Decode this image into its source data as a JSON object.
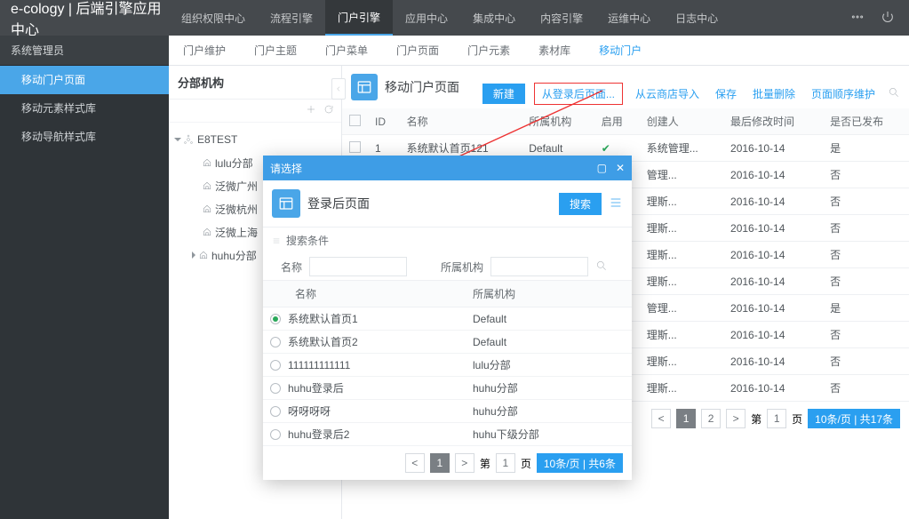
{
  "brand": "e-cology | 后端引擎应用中心",
  "topnav": [
    "组织权限中心",
    "流程引擎",
    "门户引擎",
    "应用中心",
    "集成中心",
    "内容引擎",
    "运维中心",
    "日志中心"
  ],
  "topnav_active": 2,
  "user_label": "系统管理员",
  "sidemenu": [
    "移动门户页面",
    "移动元素样式库",
    "移动导航样式库"
  ],
  "sidemenu_active": 0,
  "subtabs": [
    "门户维护",
    "门户主题",
    "门户菜单",
    "门户页面",
    "门户元素",
    "素材库",
    "移动门户"
  ],
  "subtabs_active": 6,
  "org_title": "分部机构",
  "tree": {
    "root": "E8TEST",
    "children": [
      "lulu分部",
      "泛微广州",
      "泛微杭州",
      "泛微上海",
      "huhu分部"
    ]
  },
  "page_title": "移动门户页面",
  "actions": {
    "new": "新建",
    "from_login": "从登录后页面...",
    "from_store": "从云商店导入",
    "save": "保存",
    "batch_del": "批量删除",
    "order": "页面顺序维护"
  },
  "table": {
    "cols": [
      "",
      "ID",
      "名称",
      "所属机构",
      "启用",
      "创建人",
      "最后修改时间",
      "是否已发布"
    ],
    "rows": [
      {
        "id": "1",
        "name": "系统默认首页121",
        "org": "Default",
        "enabled": true,
        "creator": "系统管理...",
        "mtime": "2016-10-14",
        "pub": "是"
      },
      {
        "id": "",
        "name": "",
        "org": "",
        "enabled": false,
        "creator": "管理...",
        "mtime": "2016-10-14",
        "pub": "否"
      },
      {
        "id": "",
        "name": "",
        "org": "",
        "enabled": false,
        "creator": "理斯...",
        "mtime": "2016-10-14",
        "pub": "否"
      },
      {
        "id": "",
        "name": "",
        "org": "",
        "enabled": false,
        "creator": "理斯...",
        "mtime": "2016-10-14",
        "pub": "否"
      },
      {
        "id": "",
        "name": "",
        "org": "",
        "enabled": false,
        "creator": "理斯...",
        "mtime": "2016-10-14",
        "pub": "否"
      },
      {
        "id": "",
        "name": "",
        "org": "",
        "enabled": false,
        "creator": "理斯...",
        "mtime": "2016-10-14",
        "pub": "否"
      },
      {
        "id": "",
        "name": "",
        "org": "",
        "enabled": false,
        "creator": "管理...",
        "mtime": "2016-10-14",
        "pub": "是"
      },
      {
        "id": "",
        "name": "",
        "org": "",
        "enabled": false,
        "creator": "理斯...",
        "mtime": "2016-10-14",
        "pub": "否"
      },
      {
        "id": "",
        "name": "",
        "org": "",
        "enabled": false,
        "creator": "理斯...",
        "mtime": "2016-10-14",
        "pub": "否"
      },
      {
        "id": "",
        "name": "",
        "org": "",
        "enabled": false,
        "creator": "理斯...",
        "mtime": "2016-10-14",
        "pub": "否"
      }
    ]
  },
  "pager": {
    "prev": "<",
    "pages": [
      "1",
      "2"
    ],
    "cur": 0,
    "next": ">",
    "jump_a": "第",
    "jump_b": "页",
    "jump_val": "1",
    "info": "10条/页 | 共17条"
  },
  "modal": {
    "hd": "请选择",
    "title": "登录后页面",
    "search_btn": "搜索",
    "cond_label": "搜索条件",
    "name_label": "名称",
    "org_label": "所属机构",
    "cols": [
      "名称",
      "所属机构"
    ],
    "rows": [
      {
        "sel": true,
        "name": "系统默认首页1",
        "org": "Default"
      },
      {
        "sel": false,
        "name": "系统默认首页2",
        "org": "Default"
      },
      {
        "sel": false,
        "name": "111111111111",
        "org": "lulu分部"
      },
      {
        "sel": false,
        "name": "huhu登录后",
        "org": "huhu分部"
      },
      {
        "sel": false,
        "name": "呀呀呀呀",
        "org": "huhu分部"
      },
      {
        "sel": false,
        "name": "huhu登录后2",
        "org": "huhu下级分部"
      }
    ],
    "pager": {
      "prev": "<",
      "pages": [
        "1"
      ],
      "cur": 0,
      "next": ">",
      "jump_a": "第",
      "jump_b": "页",
      "jump_val": "1",
      "info": "10条/页 | 共6条"
    }
  }
}
